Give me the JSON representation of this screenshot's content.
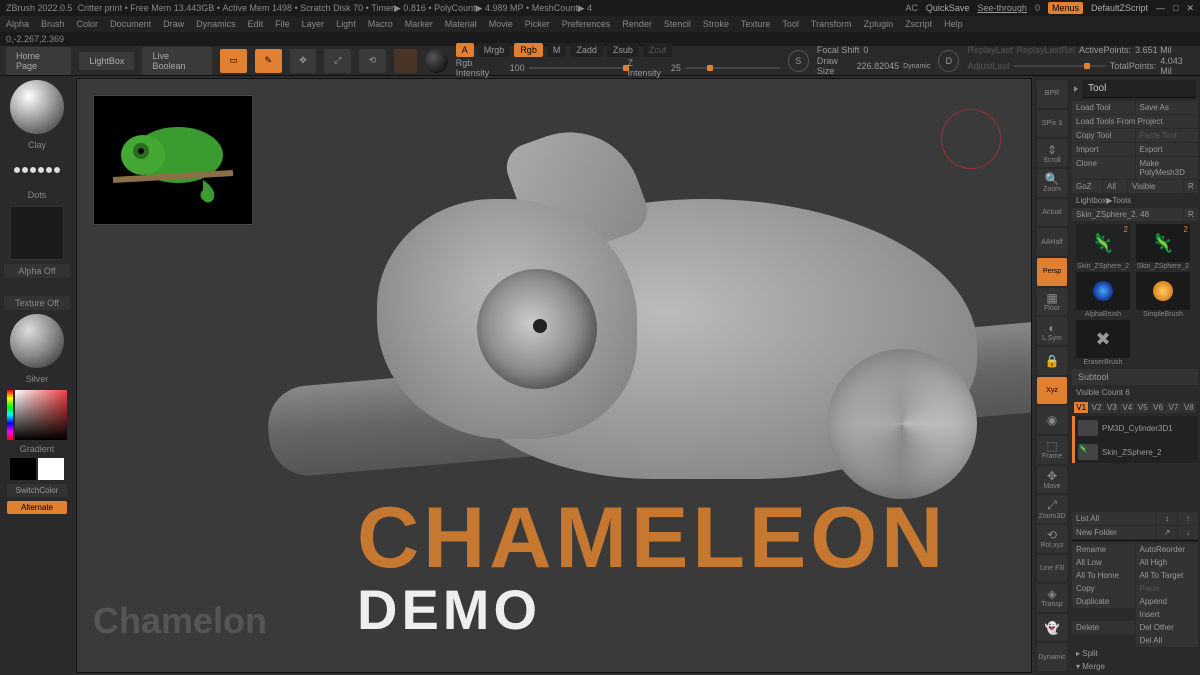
{
  "titlebar": {
    "app": "ZBrush 2022.0.5",
    "project": "Critter print",
    "freemem": "Free Mem 13.443GB",
    "activemem": "Active Mem 1498",
    "scratch": "Scratch Disk 70",
    "timer": "Timer▶ 0.816",
    "polycount": "PolyCount▶ 4.989 MP",
    "meshcount": "MeshCount▶ 4",
    "ac": "AC",
    "quicksave": "QuickSave",
    "see_through": "See-through",
    "see_val": "0",
    "menus": "Menus",
    "default": "DefaultZScript"
  },
  "menubar": [
    "Alpha",
    "Brush",
    "Color",
    "Document",
    "Draw",
    "Dynamics",
    "Edit",
    "File",
    "Layer",
    "Light",
    "Macro",
    "Marker",
    "Material",
    "Movie",
    "Picker",
    "Preferences",
    "Render",
    "Stencil",
    "Stroke",
    "Texture",
    "Tool",
    "Transform",
    "Zplugin",
    "Zscript",
    "Help"
  ],
  "coords": "0,-2.267,2.369",
  "toolbar": {
    "home": "Home Page",
    "lightbox": "LightBox",
    "liveboolean": "Live Boolean",
    "edit": "Edit",
    "draw": "Draw",
    "move": "Move",
    "scale": "Scale",
    "rotate": "Rotate",
    "a": "A",
    "mrgb": "Mrgb",
    "rgb": "Rgb",
    "m": "M",
    "zadd": "Zadd",
    "zsub": "Zsub",
    "zcut": "Zcut",
    "rgb_intensity_label": "Rgb Intensity",
    "rgb_intensity": "100",
    "z_intensity_label": "Z Intensity",
    "z_intensity": "25",
    "focal_label": "Focal Shift",
    "focal": "0",
    "drawsize_label": "Draw Size",
    "drawsize": "226.82045",
    "dynamic": "Dynamic",
    "replaylast": "ReplayLast",
    "replaylastrel": "ReplayLastRel",
    "activepoints_label": "ActivePoints:",
    "activepoints": "3.651 Mil",
    "totalpoints_label": "TotalPoints:",
    "totalpoints": "4.043 Mil"
  },
  "left": {
    "brush": "Clay",
    "stroke": "Dots",
    "alpha": "Alpha Off",
    "texture": "Texture Off",
    "material": "Silver",
    "gradient": "Gradient",
    "switch": "SwitchColor",
    "alternate": "Alternate"
  },
  "viewport": {
    "title": "CHAMELEON",
    "sub": "DEMO",
    "watermark": "Chamelon"
  },
  "righticons": [
    "BPR",
    "SPix 3",
    "Scroll",
    "Zoom",
    "Actual",
    "AAHalf",
    "Persp",
    "Floor",
    "L.Sym",
    "",
    "Xyz",
    "",
    "Frame",
    "Move",
    "Zoom3D",
    "Rot.xyz",
    "Line Fill",
    "Transp",
    "",
    "Dynamic"
  ],
  "right": {
    "tool_header": "Tool",
    "load": "Load Tool",
    "saveas": "Save As",
    "loadproject": "Load Tools From Project",
    "copytool": "Copy Tool",
    "pastetool": "Paste Tool",
    "import": "Import",
    "export": "Export",
    "clone": "Clone",
    "makepoly": "Make PolyMesh3D",
    "goz": "GoZ",
    "all": "All",
    "visible": "Visible",
    "r": "R",
    "lightbox": "Lightbox▶Tools",
    "skinname": "Skin_ZSphere_2.",
    "skinval": "48",
    "rr": "R",
    "tools": [
      {
        "name": "Skin_ZSphere_2",
        "badge": "2"
      },
      {
        "name": "Skin_ZSphere_2",
        "badge": "2"
      },
      {
        "name": "AlphaBrush",
        "badge": ""
      },
      {
        "name": "SimpleBrush",
        "badge": ""
      },
      {
        "name": "EraserBrush",
        "badge": ""
      }
    ],
    "subtool": "Subtool",
    "viscount_label": "Visible Count",
    "viscount": "6",
    "vistabs": [
      "V1",
      "V2",
      "V3",
      "V4",
      "V5",
      "V6",
      "V7",
      "V8"
    ],
    "items": [
      "PM3D_Cylinder3D1",
      "Skin_ZSphere_2"
    ],
    "listall": "List All",
    "newfolder": "New Folder",
    "rename": "Rename",
    "autoreorder": "AutoReorder",
    "alllow": "All Low",
    "allhigh": "All High",
    "alltohome": "All To Home",
    "alltotarget": "All To Target",
    "copy": "Copy",
    "paste": "Paste",
    "duplicate": "Duplicate",
    "append": "Append",
    "insert": "Insert",
    "delete": "Delete",
    "delother": "Del Other",
    "delall": "Del All",
    "split": "Split",
    "merge": "Merge"
  }
}
